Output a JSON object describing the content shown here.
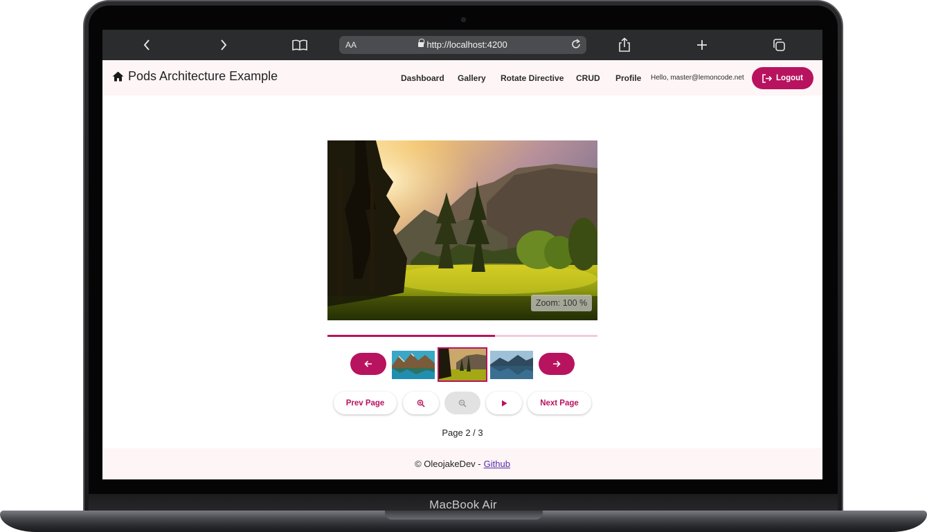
{
  "device": {
    "brand_label": "MacBook Air"
  },
  "browser": {
    "text_size_label": "AA",
    "url": "http://localhost:4200"
  },
  "header": {
    "title": "Pods Architecture Example",
    "nav": [
      "Dashboard",
      "Gallery",
      "Rotate Directive",
      "CRUD",
      "Profile"
    ],
    "greeting": "Hello, master@lemoncode.net",
    "logout_label": "Logout"
  },
  "gallery": {
    "zoom_text": "Zoom: 100 %",
    "progress_fraction": 0.62,
    "thumbnails": [
      {
        "name": "lake-mountains-thumbnail",
        "selected": false
      },
      {
        "name": "forest-meadow-thumbnail",
        "selected": true
      },
      {
        "name": "mountain-lake-thumbnail",
        "selected": false
      }
    ],
    "controls": {
      "prev_page": "Prev Page",
      "next_page": "Next Page",
      "zoom_in_icon": "zoom-in-icon",
      "zoom_out_icon": "zoom-out-icon",
      "play_icon": "play-icon"
    },
    "page_text": "Page 2 / 3"
  },
  "footer": {
    "prefix": "© OleojakeDev -",
    "link_label": "Github"
  },
  "colors": {
    "accent": "#b8135f",
    "header_bg": "#fdf5f6",
    "browser_bar": "#2a2c2e"
  }
}
